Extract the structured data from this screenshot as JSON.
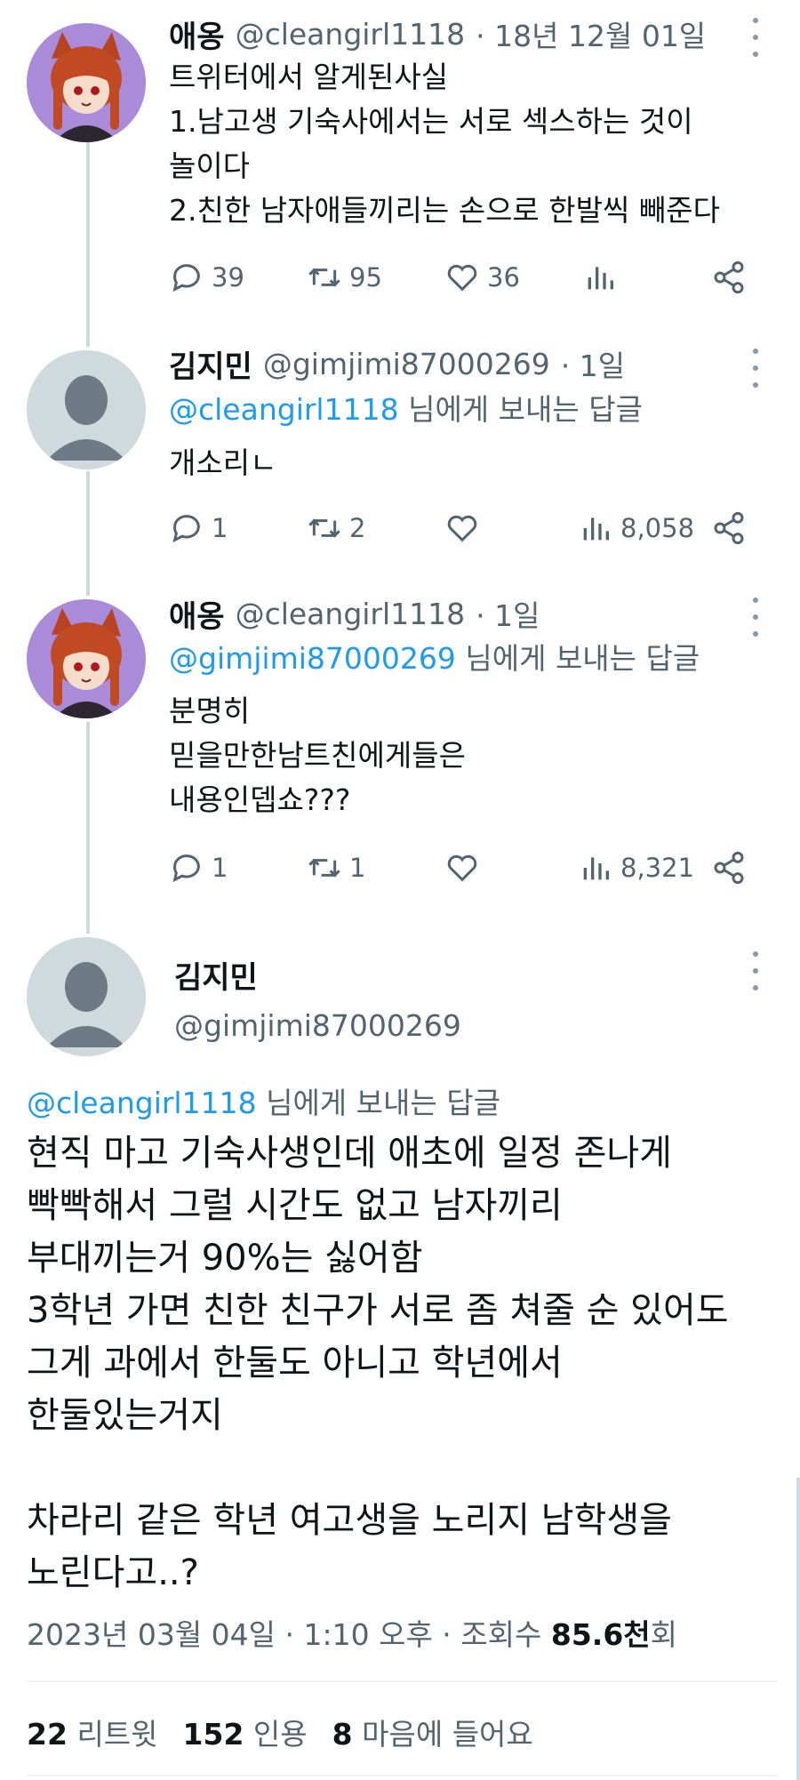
{
  "tweets": [
    {
      "name": "애옹",
      "handle": "@cleangirl1118",
      "time": "· 18년 12월 01일",
      "lines": [
        "트위터에서 알게된사실",
        "1.남고생 기숙사에서는 서로 섹스하는 것이",
        "놀이다",
        "2.친한 남자애들끼리는 손으로 한발씩 빼준다"
      ],
      "replies": "39",
      "retweets": "95",
      "likes": "36",
      "views": ""
    },
    {
      "name": "김지민",
      "handle": "@gimjimi87000269",
      "time": "· 1일",
      "reply_to": "@cleangirl1118",
      "reply_suffix": " 님에게 보내는 답글",
      "lines": [
        "개소리ㄴ"
      ],
      "replies": "1",
      "retweets": "2",
      "likes": "",
      "views": "8,058"
    },
    {
      "name": "애옹",
      "handle": "@cleangirl1118",
      "time": "· 1일",
      "reply_to": "@gimjimi87000269",
      "reply_suffix": " 님에게 보내는 답글",
      "lines": [
        "분명히",
        "믿을만한남트친에게들은",
        "내용인뎁쇼???"
      ],
      "replies": "1",
      "retweets": "1",
      "likes": "",
      "views": "8,321"
    }
  ],
  "main": {
    "name": "김지민",
    "handle": "@gimjimi87000269",
    "reply_to": "@cleangirl1118",
    "reply_suffix": " 님에게 보내는 답글",
    "lines": [
      "현직 마고 기숙사생인데 애초에 일정 존나게",
      "빡빡해서 그럴 시간도 없고 남자끼리",
      "부대끼는거 90%는 싫어함",
      "3학년 가면 친한 친구가 서로 좀 쳐줄 순 있어도",
      "그게 과에서 한둘도 아니고 학년에서",
      "한둘있는거지",
      "",
      "차라리 같은 학년 여고생을 노리지 남학생을",
      "노린다고..?"
    ],
    "timestamp": "2023년 03월 04일 · 1:10 오후 · 조회수 ",
    "views_count": "85.6천",
    "views_suffix": "회",
    "retweet_count": "22",
    "retweet_label": "리트윗",
    "quote_count": "152",
    "quote_label": "인용",
    "like_count": "8",
    "like_label": "마음에 들어요"
  },
  "icons": [
    "reply-icon",
    "retweet-icon",
    "like-icon",
    "views-icon",
    "share-icon",
    "more-icon"
  ],
  "colors": {
    "link": "#1d9bf0",
    "secondary": "#536471",
    "thread_line": "#cfd9de",
    "avatar_purple": "#a98bd9"
  }
}
